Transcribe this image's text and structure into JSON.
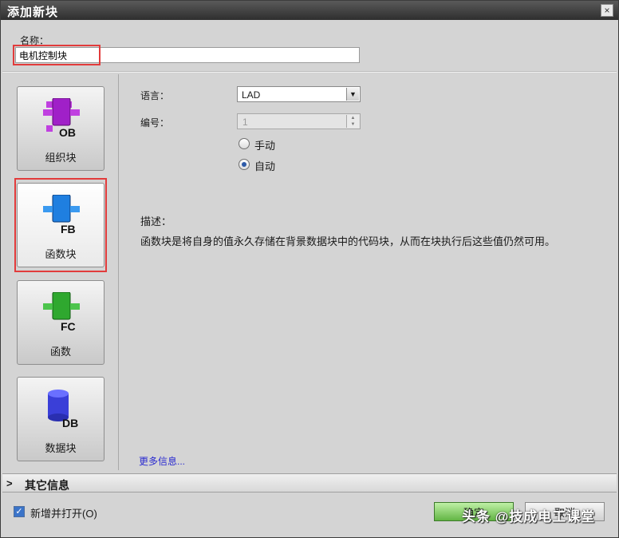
{
  "window": {
    "title": "添加新块",
    "close_glyph": "×"
  },
  "name_field": {
    "label": "名称：",
    "value": "电机控制块"
  },
  "block_types": [
    {
      "code": "OB",
      "label": "组织块",
      "color": "#a020c8"
    },
    {
      "code": "FB",
      "label": "函数块",
      "color": "#1f7fe0",
      "selected": true
    },
    {
      "code": "FC",
      "label": "函数",
      "color": "#2fa82f"
    },
    {
      "code": "DB",
      "label": "数据块",
      "color": "#3a3fd8"
    }
  ],
  "language": {
    "label": "语言：",
    "value": "LAD"
  },
  "number": {
    "label": "编号：",
    "value": "1"
  },
  "numbering_mode": {
    "manual_label": "手动",
    "auto_label": "自动",
    "selected": "auto"
  },
  "description": {
    "label": "描述：",
    "text": "函数块是将自身的值永久存储在背景数据块中的代码块，从而在块执行后这些值仍然可用。"
  },
  "more_info_link": "更多信息...",
  "other_info": {
    "title": "其它信息",
    "chevron": ">"
  },
  "footer": {
    "add_and_open_label": "新增并打开(O)",
    "add_and_open_checked": true,
    "ok_label": "确定",
    "cancel_label": "取消"
  },
  "watermark": "头条 @技成电工课堂",
  "icons": {
    "ob": "block-ob-icon",
    "fb": "block-fb-icon",
    "fc": "block-fc-icon",
    "db": "block-db-icon"
  }
}
